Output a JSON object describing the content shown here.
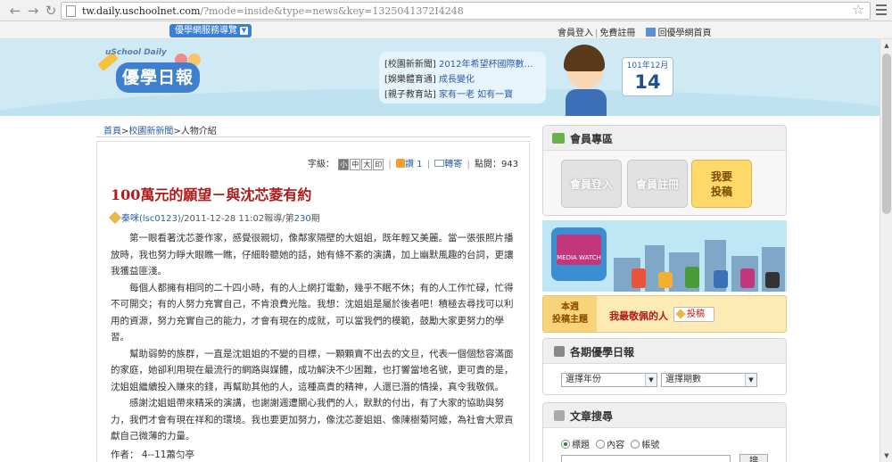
{
  "browser": {
    "back_icon": "back-arrow-icon",
    "forward_icon": "forward-arrow-icon",
    "url_host": "tw.daily.uschoolnet.com",
    "url_path": "/?mode=inside&type=news&key=1325041372I4248"
  },
  "topbar": {
    "services_label": "優學網服務導覽",
    "login": "會員登入",
    "signup": "免費註冊",
    "home": "回優學網首頁"
  },
  "header": {
    "logo_top": "uSchool Daily",
    "logo_main": "優學日報",
    "news": [
      {
        "tag": "[校園新新聞]",
        "link": "2012年希望杯國際數…"
      },
      {
        "tag": "[娛樂體育通]",
        "link": "成長變化"
      },
      {
        "tag": "[親子教育站]",
        "link": "家有一老 如有一寶"
      }
    ],
    "calendar_month": "101年12月",
    "calendar_day": "14"
  },
  "breadcrumb": {
    "home": "首頁",
    "section": "校園新新聞",
    "current": "人物介紹"
  },
  "toolbar": {
    "font_label": "字級：",
    "font_small": "小",
    "font_medium": "中",
    "font_large": "大",
    "font_print": "印",
    "likes_label": "讚",
    "likes_count": "1",
    "forward_label": "轉寄",
    "clicks_label": "點閱：",
    "clicks_count": "943"
  },
  "article": {
    "title": "100萬元的願望－與沈芯菱有約",
    "author_link": "秦咪(lsc0123)",
    "date_issue_prefix": "/2011-12-28 11:02報導/第",
    "issue": "230",
    "issue_suffix": "期",
    "paragraphs": [
      "第一眼看著沈芯菱作家，感覺很親切，像鄰家隔壁的大姐姐，既年輕又美麗。當一張張照片播放時，我也努力睜大眼瞧一瞧，仔細聆聽她的話，她有條不紊的演講，加上幽默風趣的台詞，更讓我獲益匪淺。",
      "每個人都擁有相同的二十四小時，有的人上網打電動，幾乎不眠不休；有的人工作忙碌，忙得不可開交；有的人努力充實自己，不肯浪費光陰。我想：沈姐姐是屬於後者吧！積極去尋找可以利用的資源，努力充實自己的能力，才會有現在的成就，可以當我們的模範，鼓勵大家更努力的學習。",
      "幫助弱勢的族群，一直是沈姐姐的不變的目標，一顆顆賣不出去的文旦，代表一個個愁容滿面的家庭，她卻利用現在最流行的網路與媒體，成功解決不少困難，也打響當地名號，更可貴的是，沈姐姐繼續投入賺來的錢，再幫助其他的人，這種高貴的精神，人還已潛的情操，真令我敬佩。",
      "感謝沈姐姐帶來精采的演講，也謝謝週遭關心我們的人，默默的付出，有了大家的協助與努力，我們才會有現在祥和的環境。我也要更加努力，像沈芯菱姐姐、像陳樹菊阿嬤，為社會大眾貢獻自己微薄的力量。"
    ],
    "author_line": "作者： 4--11蕭匀亭"
  },
  "sidebar": {
    "member_title": "會員專區",
    "login_btn": "會員登入",
    "register_btn": "會員註冊",
    "contribute_line1": "我要",
    "contribute_line2": "投稿",
    "banner_text": "MEDIA WATCH",
    "theme_label_line1": "本週",
    "theme_label_line2": "投稿主題",
    "theme_title": "我最敬佩的人",
    "submit_label": "投稿",
    "archive_title": "各期優學日報",
    "select_year": "選擇年份",
    "select_issue": "選擇期數",
    "search_title": "文章搜尋",
    "radio_title": "標題",
    "radio_content": "內容",
    "radio_account": "帳號",
    "search_btn": "搜"
  },
  "colors": {
    "accent": "#3a7fd5",
    "title_red": "#b01a1a",
    "link_blue": "#2c5ea8",
    "header_bg": "#cfe9f5"
  }
}
